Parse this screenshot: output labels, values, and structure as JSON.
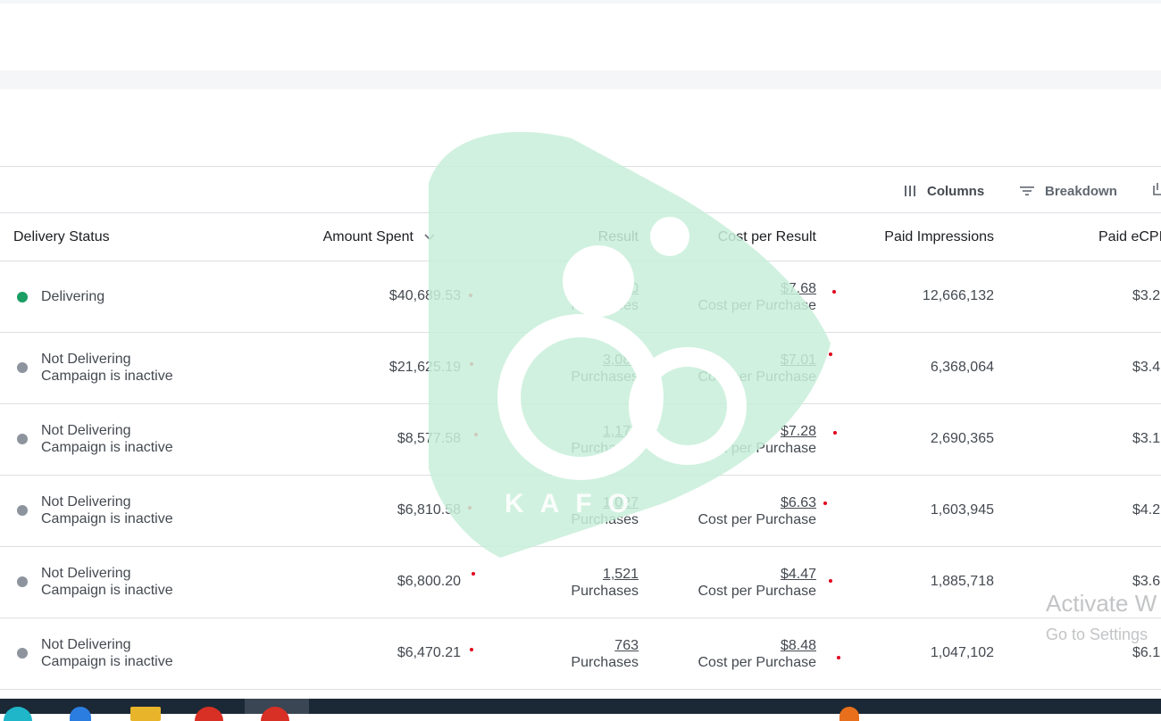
{
  "toolbar": {
    "columns_label": "Columns",
    "columns_icon": "columns-icon",
    "breakdown_label": "Breakdown",
    "breakdown_icon": "filter-lines-icon",
    "export_icon": "export-icon"
  },
  "table": {
    "headers": {
      "delivery_status": "Delivery Status",
      "amount_spent": "Amount Spent",
      "result": "Result",
      "cost_per_result": "Cost per Result",
      "paid_impressions": "Paid Impressions",
      "paid_ecpm": "Paid eCPI"
    },
    "rows": [
      {
        "status": "Delivering",
        "status_sub": "",
        "amount": "$40,689.53",
        "result": "5,300",
        "result_label": "Purchases",
        "cpr": "$7.68",
        "cpr_label": "Cost per Purchase",
        "impressions": "12,666,132",
        "ecpm": "$3.2",
        "dot_color": "#1a9e63"
      },
      {
        "status": "Not Delivering",
        "status_sub": "Campaign is inactive",
        "amount": "$21,625.19",
        "result": "3,084",
        "result_label": "Purchases",
        "cpr": "$7.01",
        "cpr_label": "Cost per Purchase",
        "impressions": "6,368,064",
        "ecpm": "$3.4",
        "dot_color": "#8d949e"
      },
      {
        "status": "Not Delivering",
        "status_sub": "Campaign is inactive",
        "amount": "$8,577.58",
        "result": "1,178",
        "result_label": "Purchases",
        "cpr": "$7.28",
        "cpr_label": "Cost per Purchase",
        "impressions": "2,690,365",
        "ecpm": "$3.1",
        "dot_color": "#8d949e"
      },
      {
        "status": "Not Delivering",
        "status_sub": "Campaign is inactive",
        "amount": "$6,810.58",
        "result": "1,027",
        "result_label": "Purchases",
        "cpr": "$6.63",
        "cpr_label": "Cost per Purchase",
        "impressions": "1,603,945",
        "ecpm": "$4.2",
        "dot_color": "#8d949e"
      },
      {
        "status": "Not Delivering",
        "status_sub": "Campaign is inactive",
        "amount": "$6,800.20",
        "result": "1,521",
        "result_label": "Purchases",
        "cpr": "$4.47",
        "cpr_label": "Cost per Purchase",
        "impressions": "1,885,718",
        "ecpm": "$3.6",
        "dot_color": "#8d949e"
      },
      {
        "status": "Not Delivering",
        "status_sub": "Campaign is inactive",
        "amount": "$6,470.21",
        "result": "763",
        "result_label": "Purchases",
        "cpr": "$8.48",
        "cpr_label": "Cost per Purchase",
        "impressions": "1,047,102",
        "ecpm": "$6.1",
        "dot_color": "#8d949e"
      }
    ]
  },
  "overlay": {
    "activate_title": "Activate W",
    "activate_sub": "Go to Settings",
    "watermark_text": "KAFO"
  },
  "colors": {
    "delivering": "#1a9e63",
    "inactive": "#8d949e",
    "annotation_red": "#e0001b",
    "watermark": "#c8efd9"
  }
}
